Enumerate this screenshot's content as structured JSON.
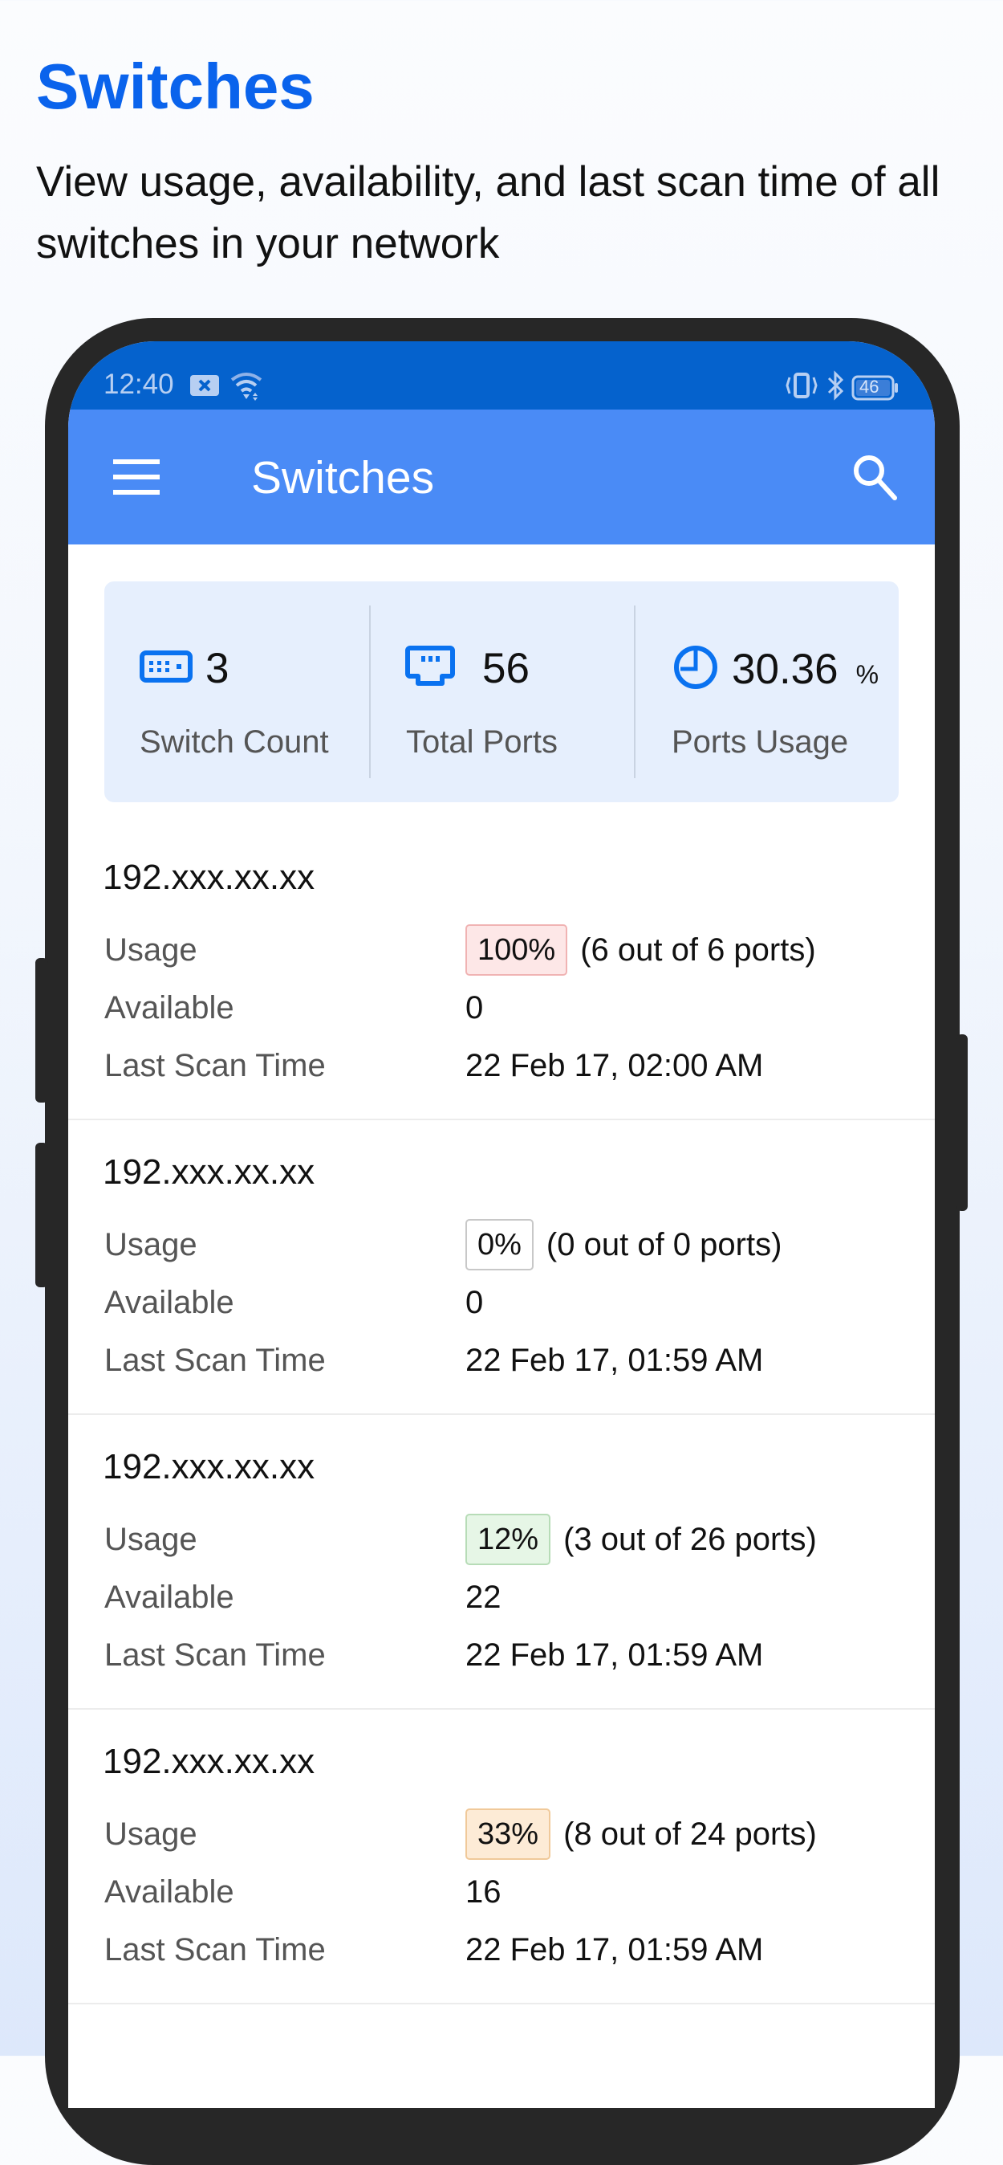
{
  "hero": {
    "title": "Switches",
    "subtitle": "View usage, availability, and last scan time of all switches in your network"
  },
  "status_bar": {
    "time": "12:40",
    "battery": "46",
    "icons_left": [
      "notification-x-icon",
      "wifi-icon"
    ],
    "icons_right": [
      "vibrate-icon",
      "bluetooth-icon",
      "battery-icon"
    ]
  },
  "app_bar": {
    "title": "Switches",
    "menu_icon": "hamburger-menu-icon",
    "search_icon": "search-icon"
  },
  "summary": [
    {
      "icon": "switch-icon",
      "value": "3",
      "suffix": "",
      "label": "Switch Count"
    },
    {
      "icon": "ethernet-port-icon",
      "value": "56",
      "suffix": "",
      "label": "Total Ports"
    },
    {
      "icon": "pie-chart-icon",
      "value": "30.36",
      "suffix": "%",
      "label": "Ports Usage"
    }
  ],
  "labels": {
    "usage": "Usage",
    "available": "Available",
    "last_scan": "Last Scan Time"
  },
  "switches": [
    {
      "ip": "192.xxx.xx.xx",
      "usage_pct": "100%",
      "usage_detail": "(6 out of 6 ports)",
      "available": "0",
      "last_scan": "22 Feb 17, 02:00 AM",
      "badge_level": "high"
    },
    {
      "ip": "192.xxx.xx.xx",
      "usage_pct": "0%",
      "usage_detail": "(0 out of 0 ports)",
      "available": "0",
      "last_scan": "22 Feb 17, 01:59 AM",
      "badge_level": "none"
    },
    {
      "ip": "192.xxx.xx.xx",
      "usage_pct": "12%",
      "usage_detail": "(3 out of 26 ports)",
      "available": "22",
      "last_scan": "22 Feb 17, 01:59 AM",
      "badge_level": "low"
    },
    {
      "ip": "192.xxx.xx.xx",
      "usage_pct": "33%",
      "usage_detail": "(8 out of 24 ports)",
      "available": "16",
      "last_scan": "22 Feb 17, 01:59 AM",
      "badge_level": "medium"
    }
  ],
  "colors": {
    "brand": "#0a63ec",
    "app_bar": "#4a8bf6",
    "status_bar": "#0562cd",
    "badge_high_bg": "#fde7e7",
    "badge_high_border": "#f0b3b3",
    "badge_none_bg": "#ffffff",
    "badge_none_border": "#c8c8c8",
    "badge_low_bg": "#e6f6e6",
    "badge_low_border": "#b7dcb7",
    "badge_medium_bg": "#fdebd6",
    "badge_medium_border": "#f0c99a"
  }
}
